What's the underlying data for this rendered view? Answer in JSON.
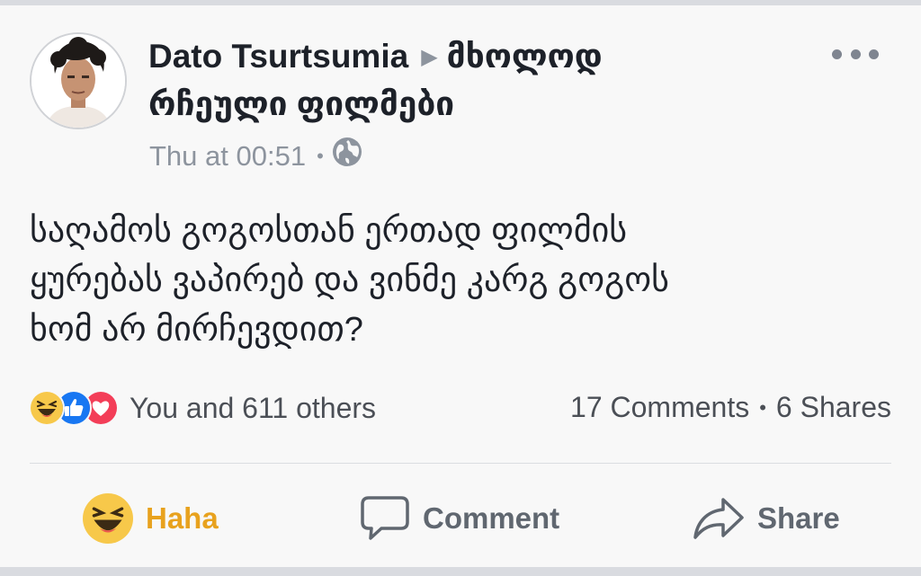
{
  "post": {
    "author": "Dato Tsurtsumia",
    "group_line1": "მხოლოდ",
    "group_line2": "რჩეული ფილმები",
    "timestamp": "Thu at 00:51",
    "audience_icon": "globe-icon",
    "text_lines": [
      "საღამოს გოგოსთან ერთად ფილმის",
      "ყურებას ვაპირებ და ვინმე კარგ გოგოს",
      "ხომ არ მირჩევდით?"
    ]
  },
  "reactions": {
    "icons": [
      "haha-icon",
      "like-icon",
      "love-icon"
    ],
    "summary": "You and 611 others",
    "comments": "17 Comments",
    "shares": "6 Shares"
  },
  "actions": {
    "haha_label": "Haha",
    "comment_label": "Comment",
    "share_label": "Share"
  },
  "colors": {
    "haha_active": "#e8a21e",
    "like_blue": "#1877f2",
    "love_red": "#f33e58",
    "text_primary": "#1d2129",
    "text_secondary": "#8d949e"
  }
}
